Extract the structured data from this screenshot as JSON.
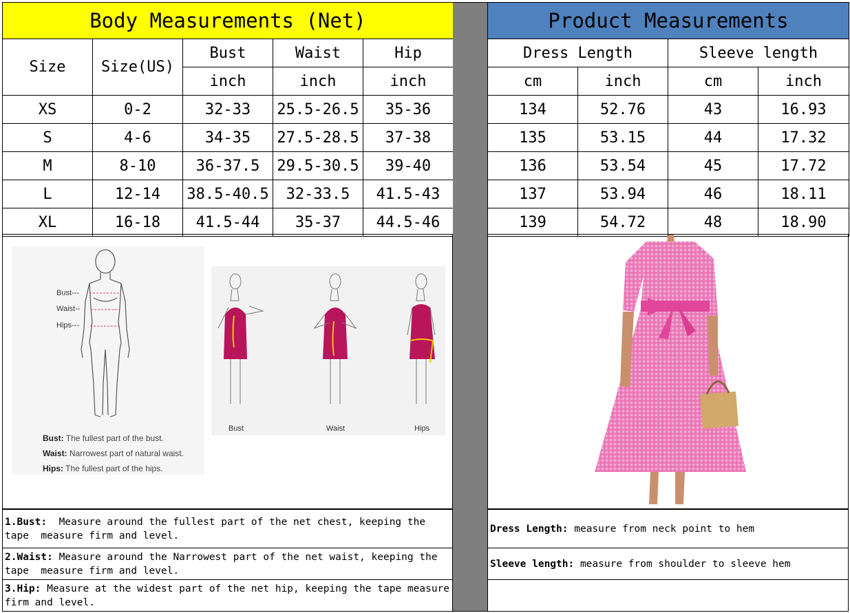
{
  "body_table": {
    "title": "Body Measurements (Net)",
    "col_size": "Size",
    "col_size_us": "Size(US)",
    "col_bust": "Bust",
    "col_waist": "Waist",
    "col_hip": "Hip",
    "unit": "inch",
    "rows": [
      {
        "size": "XS",
        "us": "0-2",
        "bust": "32-33",
        "waist": "25.5-26.5",
        "hip": "35-36"
      },
      {
        "size": "S",
        "us": "4-6",
        "bust": "34-35",
        "waist": "27.5-28.5",
        "hip": "37-38"
      },
      {
        "size": "M",
        "us": "8-10",
        "bust": "36-37.5",
        "waist": "29.5-30.5",
        "hip": "39-40"
      },
      {
        "size": "L",
        "us": "12-14",
        "bust": "38.5-40.5",
        "waist": "32-33.5",
        "hip": "41.5-43"
      },
      {
        "size": "XL",
        "us": "16-18",
        "bust": "41.5-44",
        "waist": "35-37",
        "hip": "44.5-46"
      }
    ]
  },
  "product_table": {
    "title": "Product Measurements",
    "col_dress_length": "Dress Length",
    "col_sleeve_length": "Sleeve length",
    "unit_cm": "cm",
    "unit_inch": "inch",
    "rows": [
      {
        "dress_cm": "134",
        "dress_in": "52.76",
        "sleeve_cm": "43",
        "sleeve_in": "16.93"
      },
      {
        "dress_cm": "135",
        "dress_in": "53.15",
        "sleeve_cm": "44",
        "sleeve_in": "17.32"
      },
      {
        "dress_cm": "136",
        "dress_in": "53.54",
        "sleeve_cm": "45",
        "sleeve_in": "17.72"
      },
      {
        "dress_cm": "137",
        "dress_in": "53.94",
        "sleeve_cm": "46",
        "sleeve_in": "18.11"
      },
      {
        "dress_cm": "139",
        "dress_in": "54.72",
        "sleeve_cm": "48",
        "sleeve_in": "18.90"
      }
    ]
  },
  "figure_left": {
    "bust_mark": "Bust---",
    "waist_mark": "Waist--",
    "hips_mark": "Hips---",
    "defs": [
      {
        "term": "Bust:",
        "text": "The fullest part of the bust."
      },
      {
        "term": "Waist:",
        "text": "Narrowest part of natural waist."
      },
      {
        "term": "Hips:",
        "text": "The fullest part of the hips."
      }
    ]
  },
  "figure_middle": {
    "labels": [
      "Bust",
      "Waist",
      "Hips"
    ]
  },
  "notes_left": [
    {
      "term": "1.Bust:",
      "text": "  Measure around the fullest part of the net chest, keeping the tape  measure firm and level."
    },
    {
      "term": "2.Waist:",
      "text": " Measure around the Narrowest part of the net waist, keeping the tape  measure firm and level."
    },
    {
      "term": "3.Hip:",
      "text": " Measure at the widest part of the net hip, keeping the tape measure firm and level."
    }
  ],
  "notes_right": [
    {
      "term": "Dress Length:",
      "text": " measure from neck point to hem"
    },
    {
      "term": "Sleeve length:",
      "text": " measure from shoulder to sleeve hem"
    }
  ],
  "colors": {
    "yellow_header": "#ffff00",
    "blue_header": "#4f81bd",
    "gap_gray": "#7f7f7f",
    "dress_pink": "#e85aa8",
    "figure_dress": "#b8155a"
  }
}
